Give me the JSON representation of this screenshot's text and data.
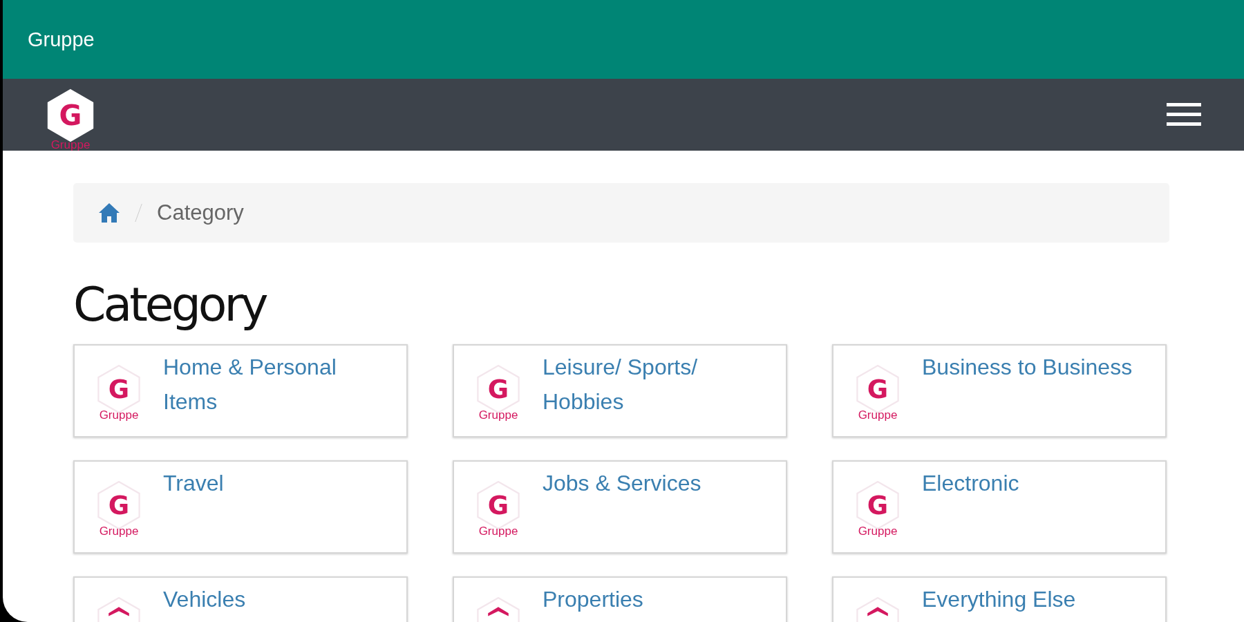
{
  "app_bar": {
    "title": "Gruppe"
  },
  "navbar": {
    "logo": {
      "letter": "G",
      "text": "Gruppe"
    }
  },
  "breadcrumb": {
    "items": [
      {
        "kind": "home"
      },
      {
        "kind": "text",
        "label": "Category"
      }
    ]
  },
  "heading": "Category",
  "categories": [
    {
      "label": "Home & Personal Items",
      "logo": {
        "letter": "G",
        "text": "Gruppe"
      }
    },
    {
      "label": "Leisure/ Sports/ Hobbies",
      "logo": {
        "letter": "G",
        "text": "Gruppe"
      }
    },
    {
      "label": "Business to Business",
      "logo": {
        "letter": "G",
        "text": "Gruppe"
      }
    },
    {
      "label": "Travel",
      "logo": {
        "letter": "G",
        "text": "Gruppe"
      }
    },
    {
      "label": "Jobs & Services",
      "logo": {
        "letter": "G",
        "text": "Gruppe"
      }
    },
    {
      "label": "Electronic",
      "logo": {
        "letter": "G",
        "text": "Gruppe"
      }
    },
    {
      "label": "Vehicles"
    },
    {
      "label": "Properties"
    },
    {
      "label": "Everything Else"
    }
  ]
}
